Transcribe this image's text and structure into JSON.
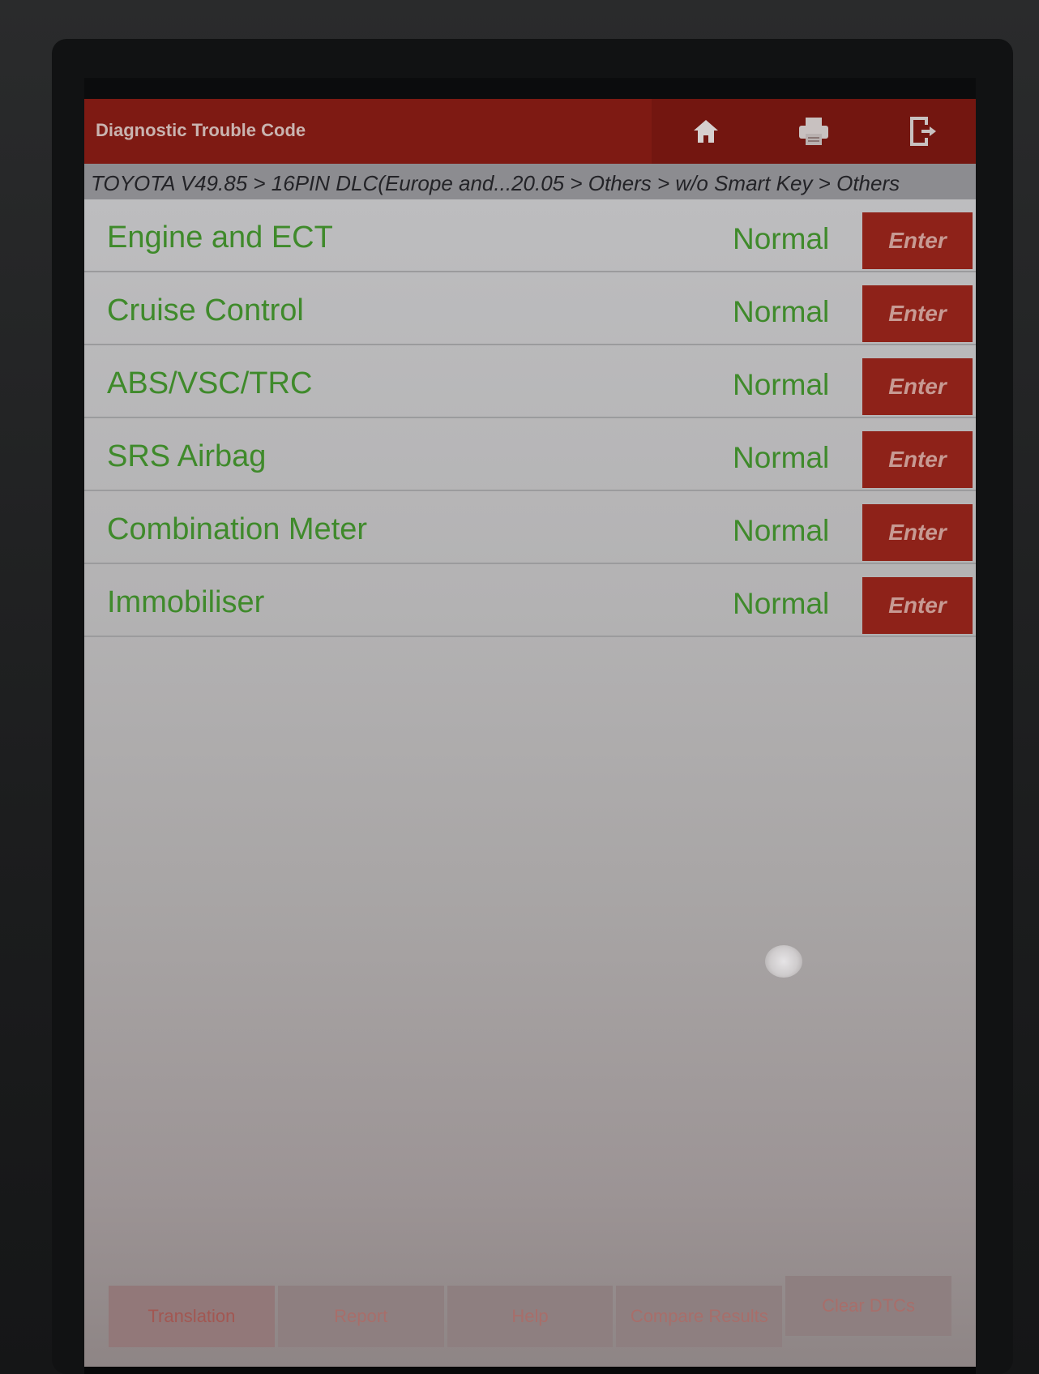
{
  "header": {
    "title": "Diagnostic Trouble Code",
    "icons": [
      "home-icon",
      "print-icon",
      "exit-icon"
    ]
  },
  "breadcrumb": {
    "text": "TOYOTA V49.85 > 16PIN DLC(Europe and...20.05 > Others > w/o Smart Key > Others"
  },
  "systems": [
    {
      "name": "Engine and ECT",
      "status": "Normal",
      "button": "Enter"
    },
    {
      "name": "Cruise Control",
      "status": "Normal",
      "button": "Enter"
    },
    {
      "name": "ABS/VSC/TRC",
      "status": "Normal",
      "button": "Enter"
    },
    {
      "name": "SRS Airbag",
      "status": "Normal",
      "button": "Enter"
    },
    {
      "name": "Combination Meter",
      "status": "Normal",
      "button": "Enter"
    },
    {
      "name": "Immobiliser",
      "status": "Normal",
      "button": "Enter"
    }
  ],
  "toolbar": {
    "translation": "Translation",
    "report": "Report",
    "help": "Help",
    "compare_results": "Compare Results",
    "clear_dtcs": "Clear DTCs"
  },
  "colors": {
    "header": "#7e1a13",
    "status_text": "#3f8a2b",
    "enter_button": "#8e2219"
  }
}
